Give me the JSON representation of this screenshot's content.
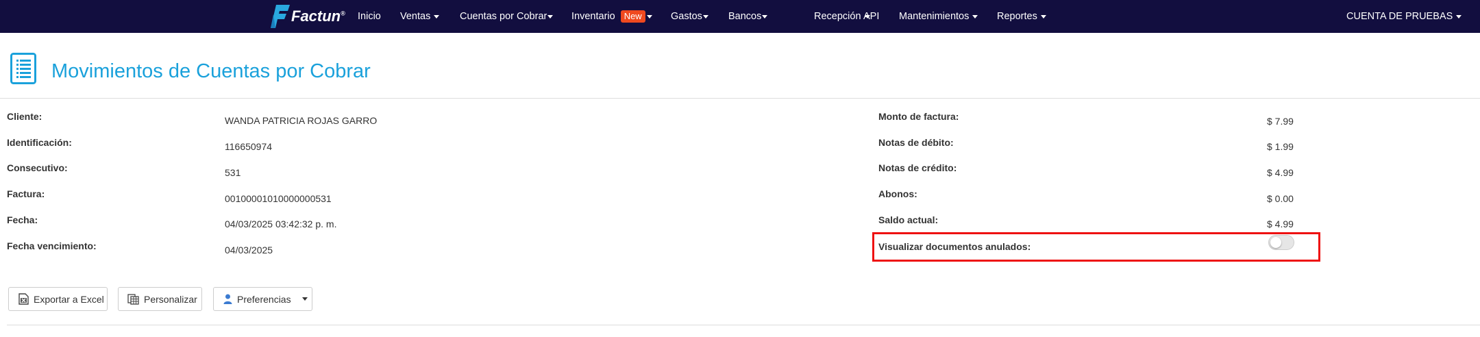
{
  "nav": {
    "brand": "Factun",
    "brand_mark": "®",
    "items": [
      {
        "label": "Inicio"
      },
      {
        "label": "Ventas"
      },
      {
        "label": "Cuentas por Cobrar"
      },
      {
        "label": "Inventario",
        "badge": "New"
      },
      {
        "label": "Gastos"
      },
      {
        "label": "Bancos"
      },
      {
        "label": "Recepción"
      },
      {
        "label": "API"
      },
      {
        "label": "Mantenimientos"
      },
      {
        "label": "Reportes"
      }
    ],
    "account": "CUENTA DE PRUEBAS",
    "colors": {
      "bar": "#120e3f",
      "badge": "#f0491f"
    }
  },
  "page": {
    "title": "Movimientos de Cuentas por Cobrar",
    "icon": "document-list-icon",
    "title_color": "#1aa1db"
  },
  "details_left": [
    {
      "label": "Cliente:",
      "value": "WANDA PATRICIA ROJAS GARRO"
    },
    {
      "label": "Identificación:",
      "value": "116650974"
    },
    {
      "label": "Consecutivo:",
      "value": "531"
    },
    {
      "label": "Factura:",
      "value": "00100001010000000531"
    },
    {
      "label": "Fecha:",
      "value": "04/03/2025 03:42:32 p. m."
    },
    {
      "label": "Fecha vencimiento:",
      "value": "04/03/2025"
    }
  ],
  "details_right": [
    {
      "label": "Monto de factura:",
      "value": "$ 7.99"
    },
    {
      "label": "Notas de débito:",
      "value": "$ 1.99"
    },
    {
      "label": "Notas de crédito:",
      "value": "$ 4.99"
    },
    {
      "label": "Abonos:",
      "value": "$ 0.00"
    },
    {
      "label": "Saldo actual:",
      "value": "$ 4.99"
    }
  ],
  "toggle": {
    "label": "Visualizar documentos anulados:",
    "on": false
  },
  "toolbar": {
    "export": "Exportar a Excel",
    "customize": "Personalizar",
    "preferences": "Preferencias"
  }
}
